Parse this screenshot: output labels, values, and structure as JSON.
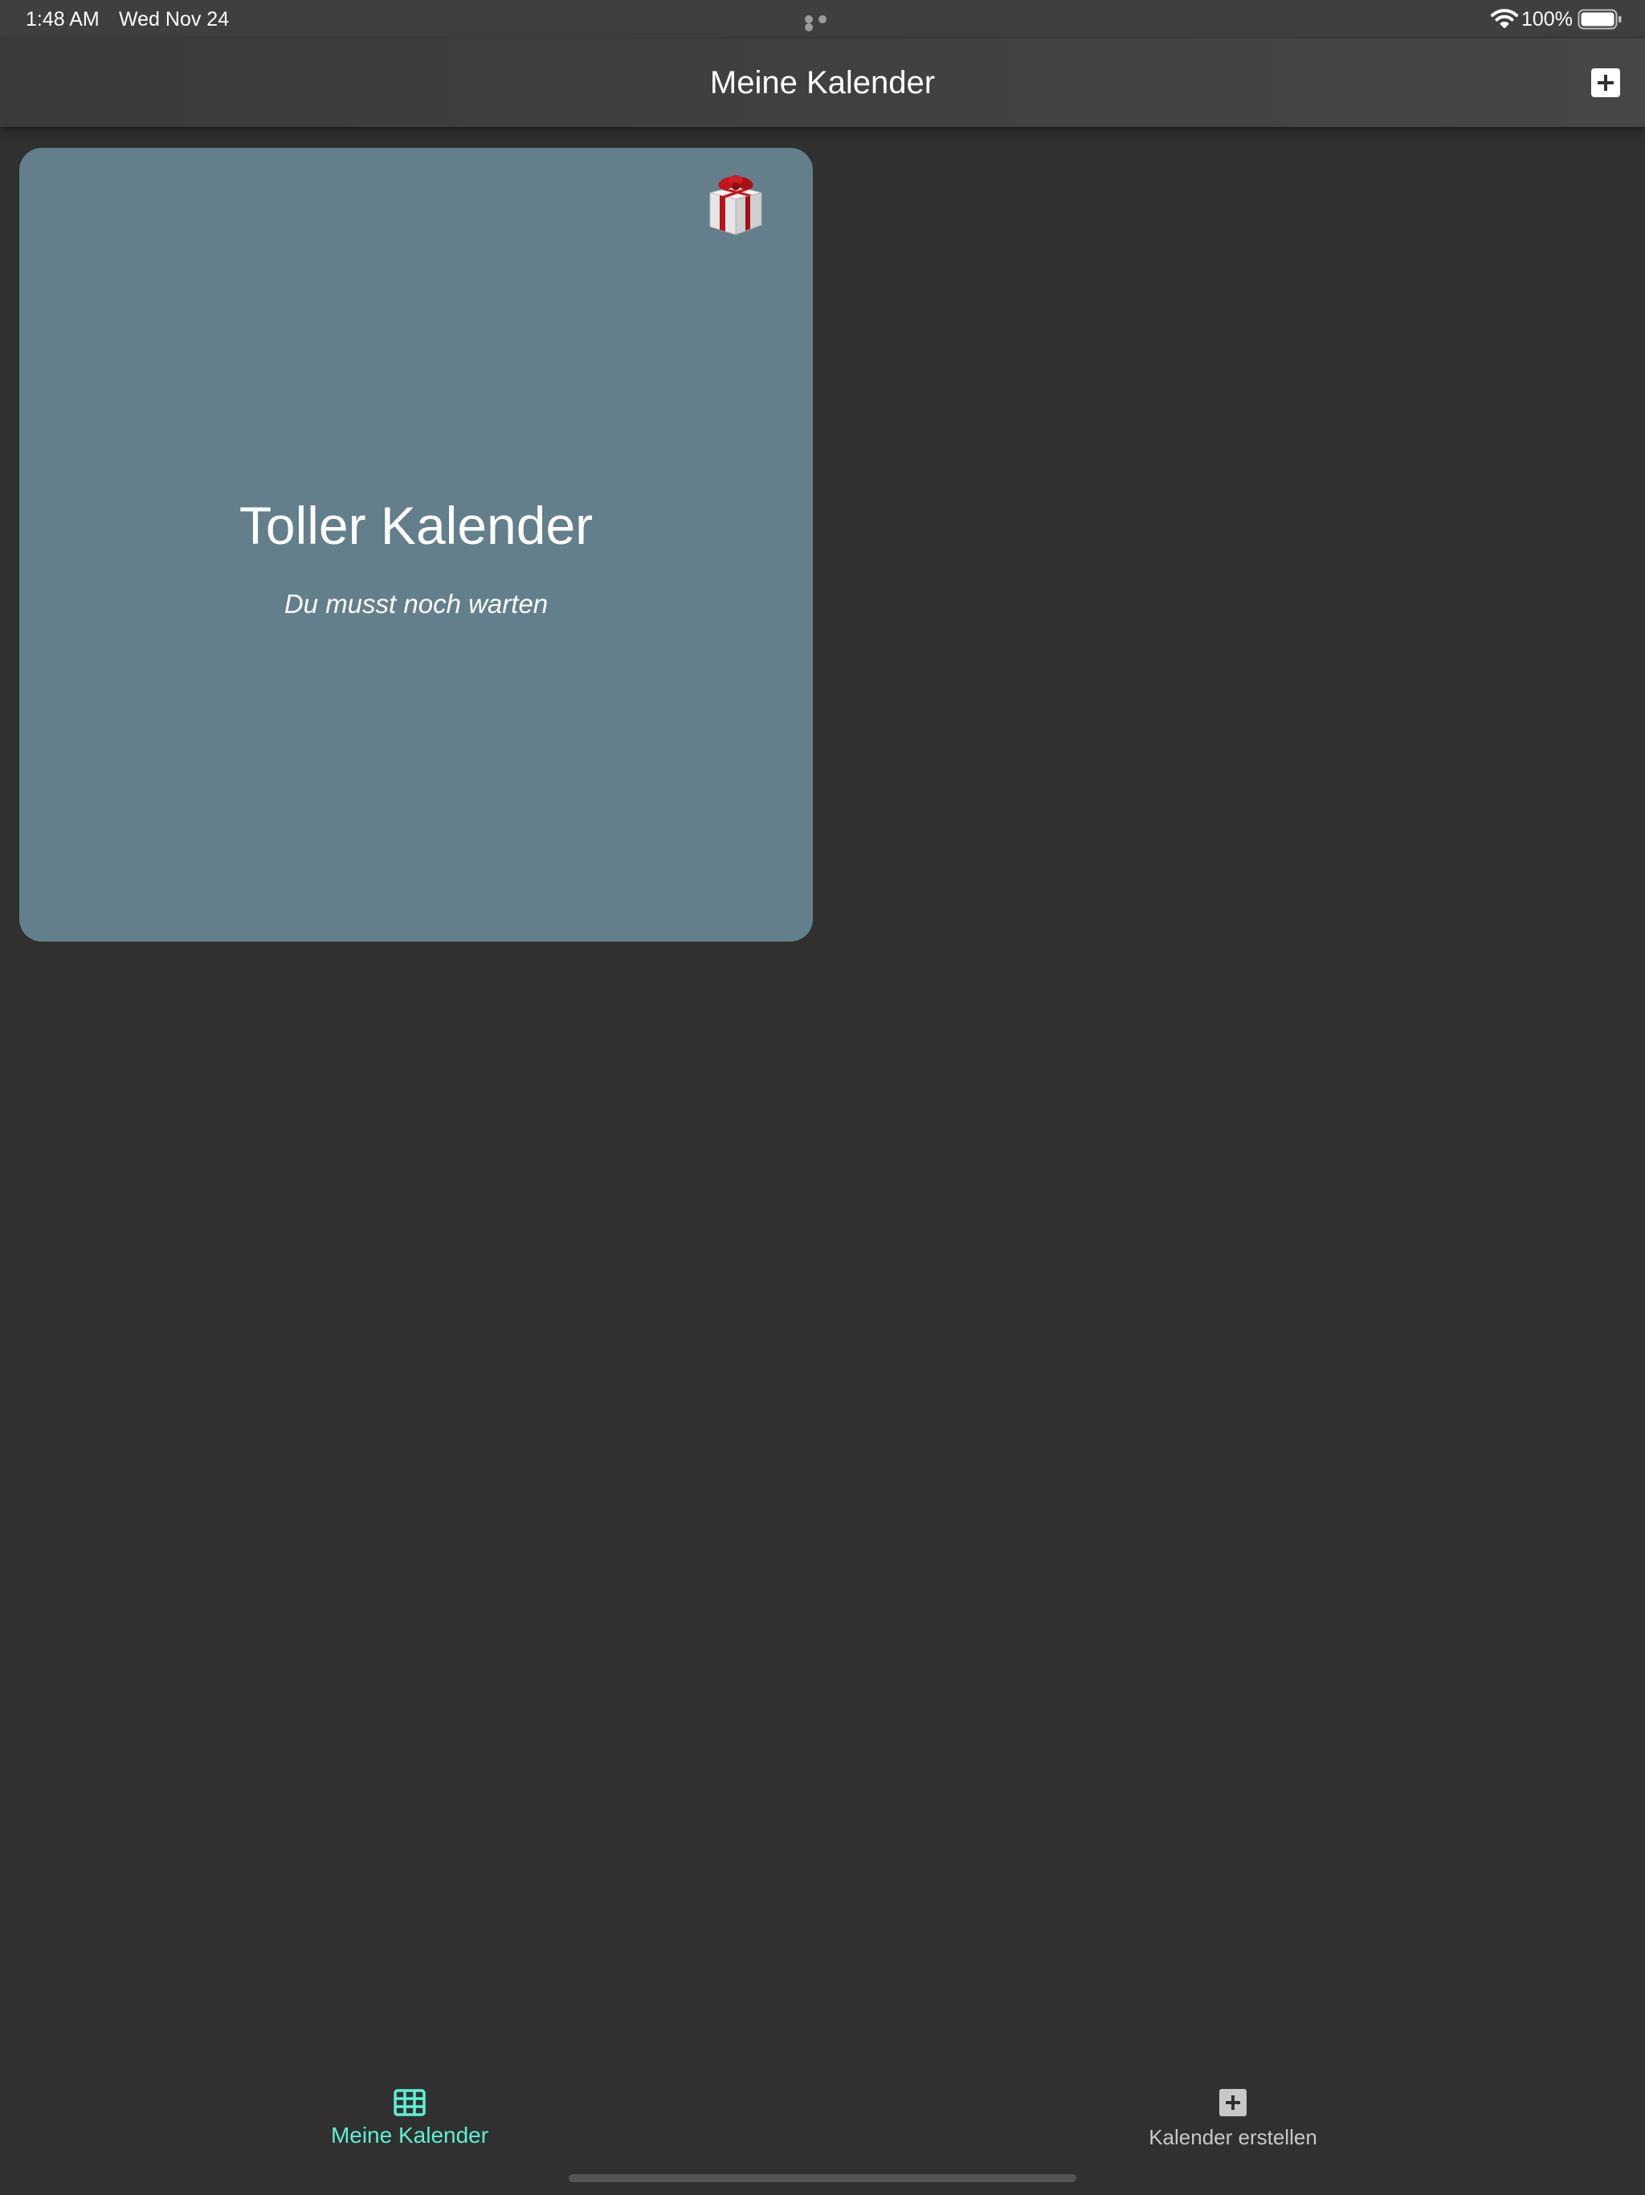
{
  "status_bar": {
    "time": "1:48 AM",
    "date": "Wed Nov 24",
    "battery_percent": "100%",
    "battery_level": 1.0,
    "icons": [
      "multitasking-dots",
      "wifi-icon",
      "battery-icon"
    ]
  },
  "nav_bar": {
    "title": "Meine Kalender",
    "action_icon": "plus-square-icon"
  },
  "calendars": [
    {
      "title": "Toller Kalender",
      "status": "Du musst noch warten",
      "icon": "gift-icon",
      "background_color": "#627f8b"
    }
  ],
  "tab_bar": {
    "items": [
      {
        "label": "Meine Kalender",
        "icon": "grid-icon",
        "active": true
      },
      {
        "label": "Kalender erstellen",
        "icon": "plus-square-icon",
        "active": false
      }
    ]
  },
  "colors": {
    "background": "#303030",
    "nav_bar": "#424242",
    "card": "#627f8b",
    "accent": "#5ef0d2",
    "inactive_tab": "#c8c8c8"
  }
}
